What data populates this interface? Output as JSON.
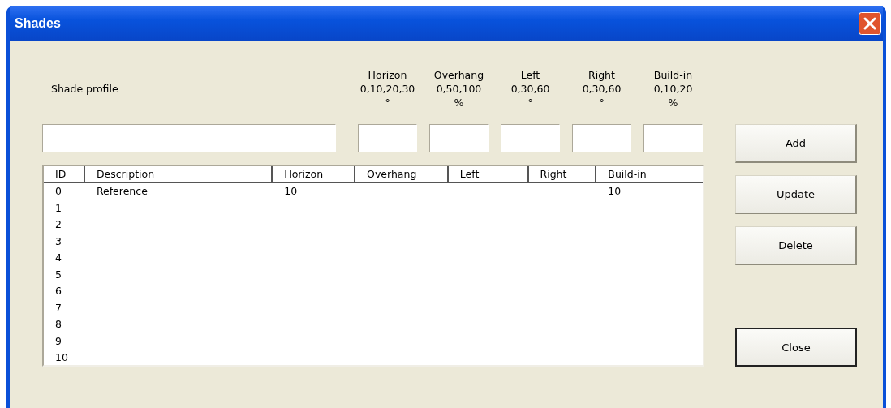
{
  "window": {
    "title": "Shades"
  },
  "profile": {
    "label": "Shade profile"
  },
  "parameters": [
    {
      "name": "Horizon",
      "range": "0,10,20,30",
      "unit": "°"
    },
    {
      "name": "Overhang",
      "range": "0,50,100",
      "unit": "%"
    },
    {
      "name": "Left",
      "range": "0,30,60",
      "unit": "°"
    },
    {
      "name": "Right",
      "range": "0,30,60",
      "unit": "°"
    },
    {
      "name": "Build-in",
      "range": "0,10,20",
      "unit": "%"
    }
  ],
  "table": {
    "columns": [
      "ID",
      "Description",
      "Horizon",
      "Overhang",
      "Left",
      "Right",
      "Build-in"
    ],
    "rows": [
      {
        "id": "0",
        "description": "Reference",
        "horizon": "10",
        "build_in": "10"
      },
      {
        "id": "1"
      },
      {
        "id": "2"
      },
      {
        "id": "3"
      },
      {
        "id": "4"
      },
      {
        "id": "5"
      },
      {
        "id": "6"
      },
      {
        "id": "7"
      },
      {
        "id": "8"
      },
      {
        "id": "9"
      },
      {
        "id": "10"
      }
    ]
  },
  "buttons": [
    {
      "label": "Add",
      "default": false
    },
    {
      "label": "Update",
      "default": false
    },
    {
      "label": "Delete",
      "default": false
    },
    {
      "label": "Close",
      "default": true
    }
  ]
}
